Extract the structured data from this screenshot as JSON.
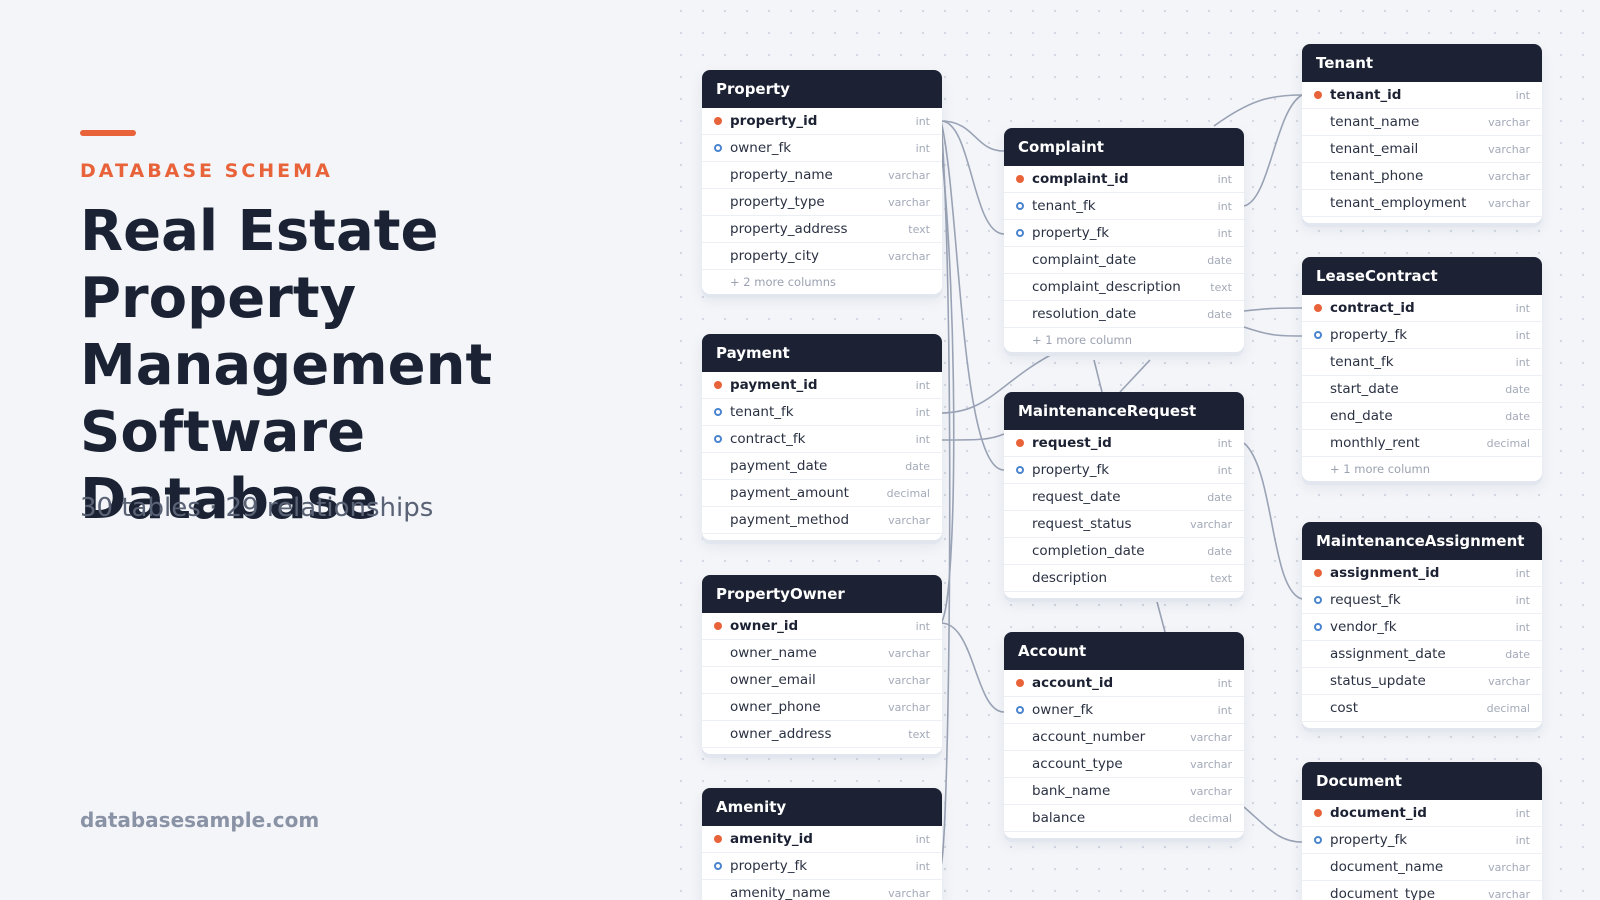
{
  "header": {
    "eyebrow": "DATABASE SCHEMA",
    "title_lines": [
      "Real Estate",
      "Property",
      "Management",
      "Software Database"
    ],
    "subtitle": "30 tables · 29 relationships",
    "site": "databasesample.com"
  },
  "colors": {
    "accent": "#e8633a",
    "header_bg": "#1c2233",
    "fk_ring": "#4a84cf",
    "link": "#9aa3b5"
  },
  "tables": [
    {
      "name": "Property",
      "columns": [
        {
          "name": "property_id",
          "type": "int",
          "key": "pk"
        },
        {
          "name": "owner_fk",
          "type": "int",
          "key": "fk"
        },
        {
          "name": "property_name",
          "type": "varchar",
          "key": ""
        },
        {
          "name": "property_type",
          "type": "varchar",
          "key": ""
        },
        {
          "name": "property_address",
          "type": "text",
          "key": ""
        },
        {
          "name": "property_city",
          "type": "varchar",
          "key": ""
        }
      ],
      "more": "+ 2 more columns"
    },
    {
      "name": "Payment",
      "columns": [
        {
          "name": "payment_id",
          "type": "int",
          "key": "pk"
        },
        {
          "name": "tenant_fk",
          "type": "int",
          "key": "fk"
        },
        {
          "name": "contract_fk",
          "type": "int",
          "key": "fk"
        },
        {
          "name": "payment_date",
          "type": "date",
          "key": ""
        },
        {
          "name": "payment_amount",
          "type": "decimal",
          "key": ""
        },
        {
          "name": "payment_method",
          "type": "varchar",
          "key": ""
        }
      ],
      "more": ""
    },
    {
      "name": "PropertyOwner",
      "columns": [
        {
          "name": "owner_id",
          "type": "int",
          "key": "pk"
        },
        {
          "name": "owner_name",
          "type": "varchar",
          "key": ""
        },
        {
          "name": "owner_email",
          "type": "varchar",
          "key": ""
        },
        {
          "name": "owner_phone",
          "type": "varchar",
          "key": ""
        },
        {
          "name": "owner_address",
          "type": "text",
          "key": ""
        }
      ],
      "more": ""
    },
    {
      "name": "Amenity",
      "columns": [
        {
          "name": "amenity_id",
          "type": "int",
          "key": "pk"
        },
        {
          "name": "property_fk",
          "type": "int",
          "key": "fk"
        },
        {
          "name": "amenity_name",
          "type": "varchar",
          "key": ""
        }
      ],
      "more": ""
    },
    {
      "name": "Complaint",
      "columns": [
        {
          "name": "complaint_id",
          "type": "int",
          "key": "pk"
        },
        {
          "name": "tenant_fk",
          "type": "int",
          "key": "fk"
        },
        {
          "name": "property_fk",
          "type": "int",
          "key": "fk"
        },
        {
          "name": "complaint_date",
          "type": "date",
          "key": ""
        },
        {
          "name": "complaint_description",
          "type": "text",
          "key": ""
        },
        {
          "name": "resolution_date",
          "type": "date",
          "key": ""
        }
      ],
      "more": "+ 1 more column"
    },
    {
      "name": "MaintenanceRequest",
      "columns": [
        {
          "name": "request_id",
          "type": "int",
          "key": "pk"
        },
        {
          "name": "property_fk",
          "type": "int",
          "key": "fk"
        },
        {
          "name": "request_date",
          "type": "date",
          "key": ""
        },
        {
          "name": "request_status",
          "type": "varchar",
          "key": ""
        },
        {
          "name": "completion_date",
          "type": "date",
          "key": ""
        },
        {
          "name": "description",
          "type": "text",
          "key": ""
        }
      ],
      "more": ""
    },
    {
      "name": "Account",
      "columns": [
        {
          "name": "account_id",
          "type": "int",
          "key": "pk"
        },
        {
          "name": "owner_fk",
          "type": "int",
          "key": "fk"
        },
        {
          "name": "account_number",
          "type": "varchar",
          "key": ""
        },
        {
          "name": "account_type",
          "type": "varchar",
          "key": ""
        },
        {
          "name": "bank_name",
          "type": "varchar",
          "key": ""
        },
        {
          "name": "balance",
          "type": "decimal",
          "key": ""
        }
      ],
      "more": ""
    },
    {
      "name": "Tenant",
      "columns": [
        {
          "name": "tenant_id",
          "type": "int",
          "key": "pk"
        },
        {
          "name": "tenant_name",
          "type": "varchar",
          "key": ""
        },
        {
          "name": "tenant_email",
          "type": "varchar",
          "key": ""
        },
        {
          "name": "tenant_phone",
          "type": "varchar",
          "key": ""
        },
        {
          "name": "tenant_employment",
          "type": "varchar",
          "key": ""
        }
      ],
      "more": ""
    },
    {
      "name": "LeaseContract",
      "columns": [
        {
          "name": "contract_id",
          "type": "int",
          "key": "pk"
        },
        {
          "name": "property_fk",
          "type": "int",
          "key": "fk"
        },
        {
          "name": "tenant_fk",
          "type": "int",
          "key": ""
        },
        {
          "name": "start_date",
          "type": "date",
          "key": ""
        },
        {
          "name": "end_date",
          "type": "date",
          "key": ""
        },
        {
          "name": "monthly_rent",
          "type": "decimal",
          "key": ""
        }
      ],
      "more": "+ 1 more column"
    },
    {
      "name": "MaintenanceAssignment",
      "columns": [
        {
          "name": "assignment_id",
          "type": "int",
          "key": "pk"
        },
        {
          "name": "request_fk",
          "type": "int",
          "key": "fk"
        },
        {
          "name": "vendor_fk",
          "type": "int",
          "key": "fk"
        },
        {
          "name": "assignment_date",
          "type": "date",
          "key": ""
        },
        {
          "name": "status_update",
          "type": "varchar",
          "key": ""
        },
        {
          "name": "cost",
          "type": "decimal",
          "key": ""
        }
      ],
      "more": ""
    },
    {
      "name": "Document",
      "columns": [
        {
          "name": "document_id",
          "type": "int",
          "key": "pk"
        },
        {
          "name": "property_fk",
          "type": "int",
          "key": "fk"
        },
        {
          "name": "document_name",
          "type": "varchar",
          "key": ""
        },
        {
          "name": "document_type",
          "type": "varchar",
          "key": ""
        }
      ],
      "more": ""
    }
  ]
}
